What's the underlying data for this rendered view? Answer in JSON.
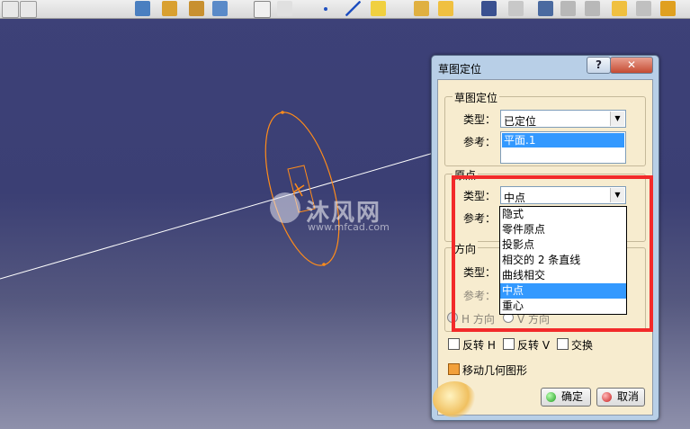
{
  "window": {
    "title": "草图定位",
    "help_label": "?",
    "close_label": "✕"
  },
  "watermark": {
    "text": "沐风网",
    "url": "www.mfcad.com"
  },
  "sketch_positioning": {
    "legend": "草图定位",
    "type_label": "类型：",
    "type_value": "已定位",
    "reference_label": "参考：",
    "reference_value": "平面.1"
  },
  "origin": {
    "legend": "原点",
    "type_label": "类型：",
    "type_value": "中点",
    "reference_label": "参考：",
    "options": [
      "隐式",
      "零件原点",
      "投影点",
      "相交的 2 条直线",
      "曲线相交",
      "中点",
      "重心"
    ],
    "selected_option": "中点"
  },
  "direction": {
    "legend": "方向",
    "type_label": "类型：",
    "reference_label": "参考：",
    "h_direction_label": "H 方向",
    "v_direction_label": "V 方向"
  },
  "options": {
    "reverse_h_label": "反转 H",
    "reverse_v_label": "反转 V",
    "swap_label": "交换",
    "move_geometry_label": "移动几何图形"
  },
  "buttons": {
    "ok_label": "确定",
    "cancel_label": "取消"
  },
  "colors": {
    "highlight": "#f22a2a",
    "selection": "#3399ff",
    "panel": "#f7eccf",
    "sketch": "#ff8c1a"
  }
}
